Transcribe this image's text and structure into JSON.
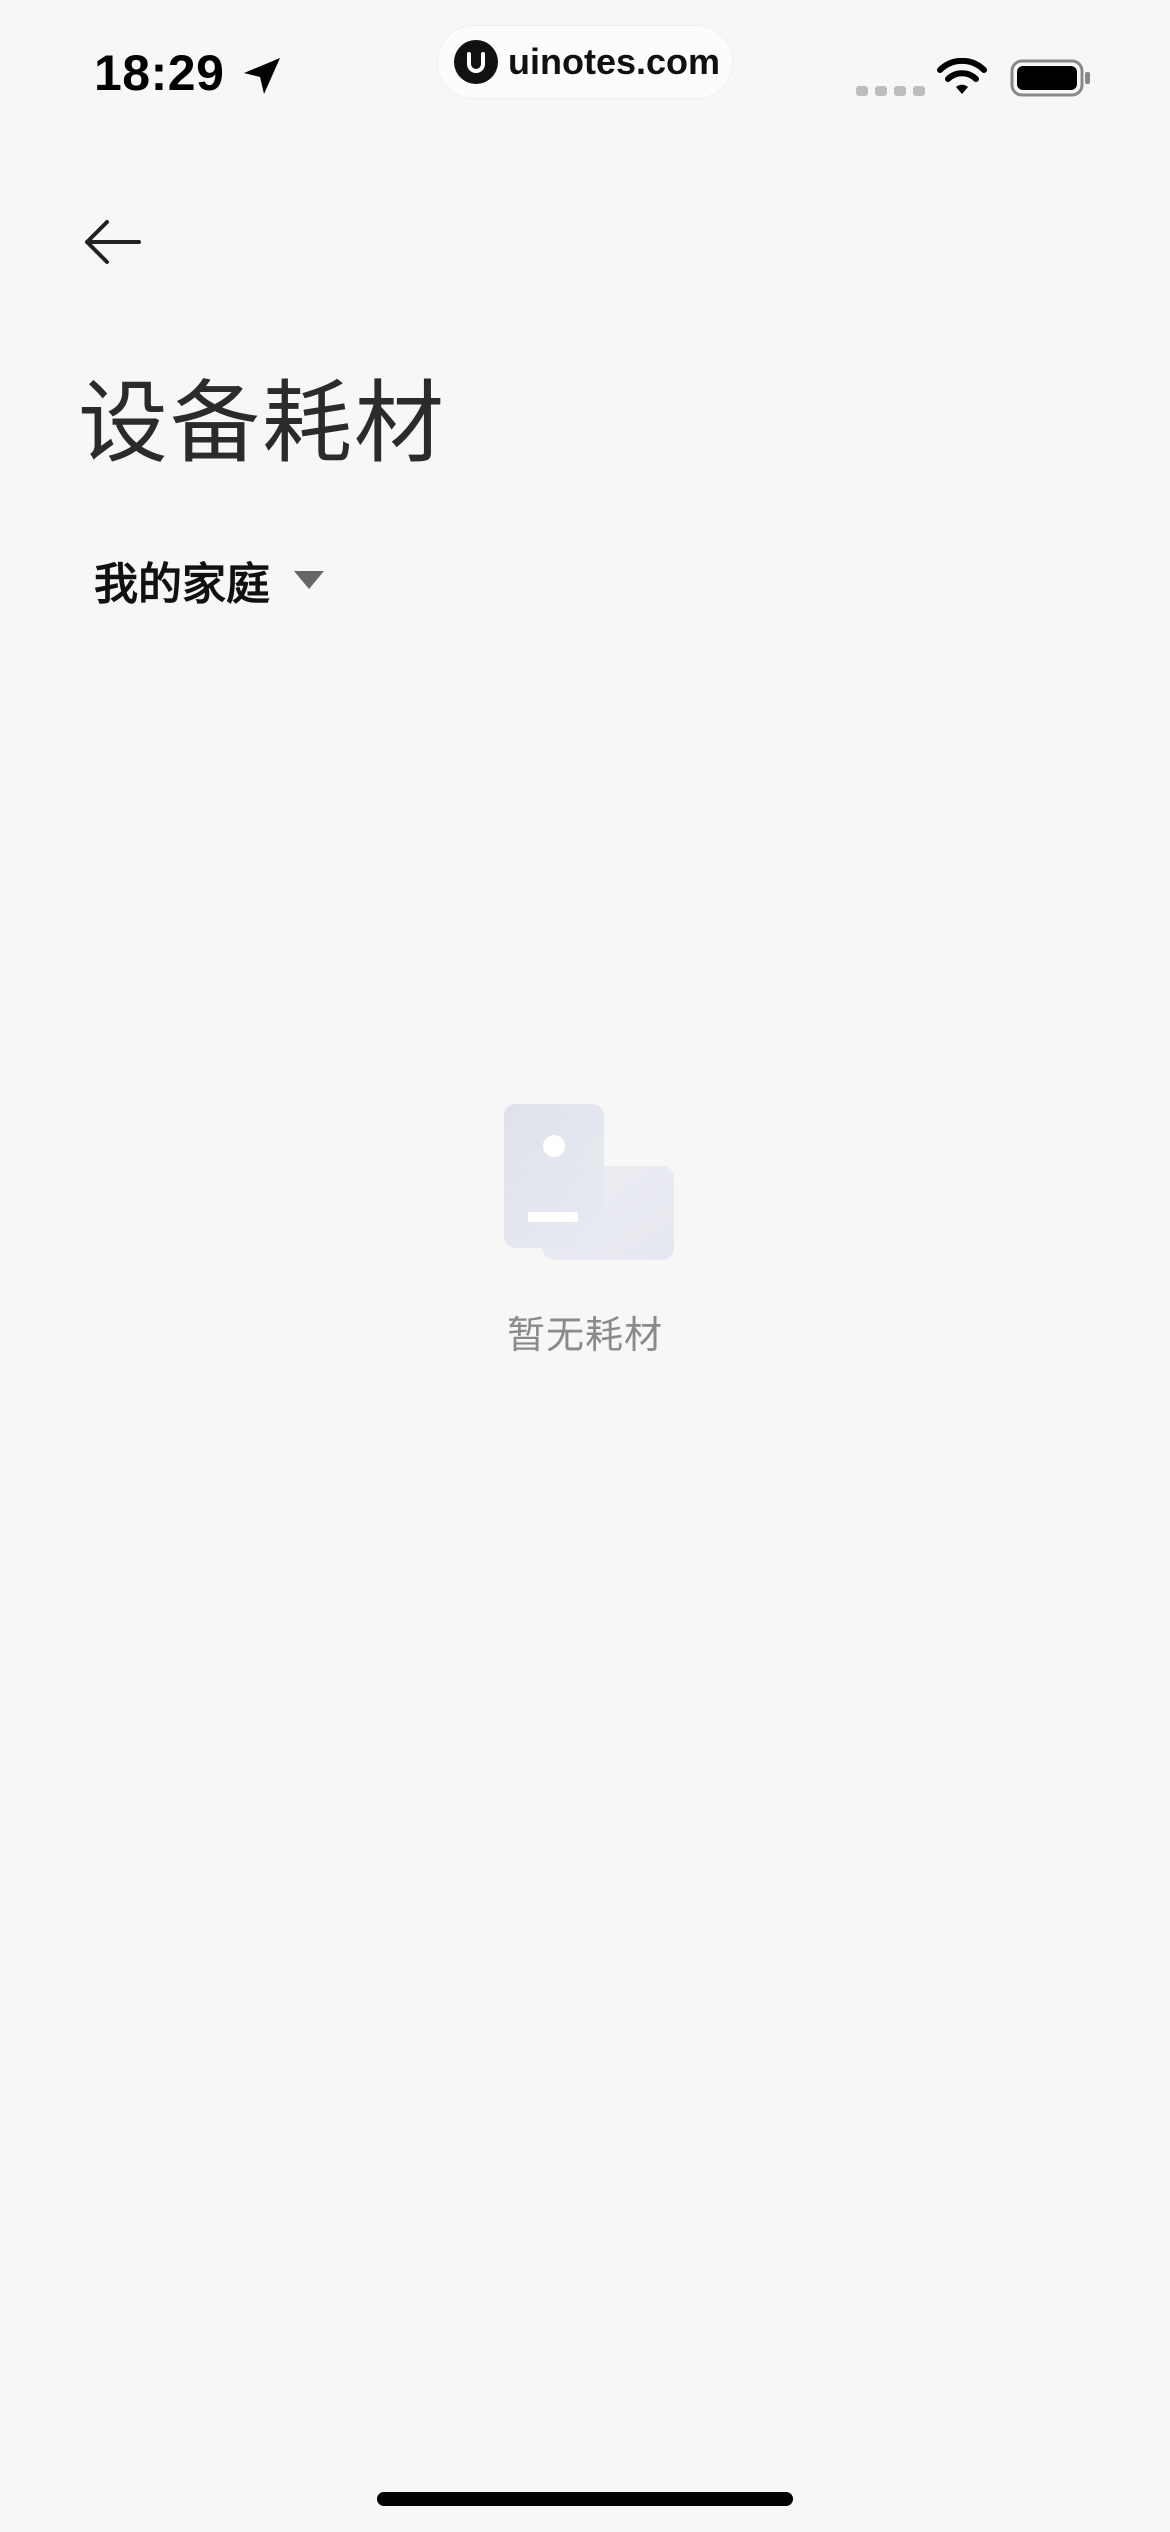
{
  "status_bar": {
    "time": "18:29",
    "location_icon": "location-arrow-icon",
    "wifi_icon": "wifi-icon",
    "battery_icon": "battery-icon"
  },
  "watermark": {
    "logo_icon": "uinotes-logo-icon",
    "site": "uinotes.com"
  },
  "header": {
    "back_icon": "arrow-left-icon",
    "title": "设备耗材",
    "home_selector": {
      "label": "我的家庭",
      "caret_icon": "triangle-down-icon"
    }
  },
  "empty_state": {
    "illustration": "empty-consumables-illustration",
    "message": "暂无耗材"
  },
  "colors": {
    "background": "#f7f7f7",
    "title": "#2b2b2b",
    "muted_text": "#8a8a8a",
    "illustration": "#e4e6ef"
  }
}
